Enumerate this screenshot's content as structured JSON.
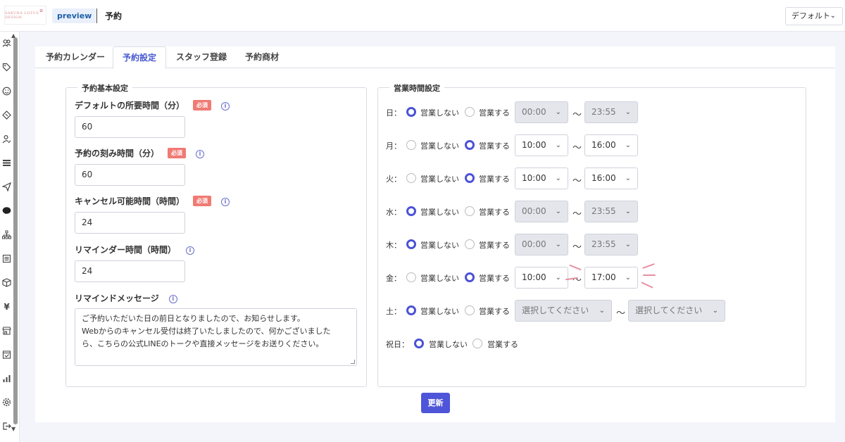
{
  "header": {
    "logo_text": "SAKURA LOTUS DESIGN",
    "preview_badge": "preview",
    "page_title": "予約",
    "default_select": "デフォルト"
  },
  "tabs": [
    {
      "label": "予約カレンダー",
      "active": false
    },
    {
      "label": "予約設定",
      "active": true
    },
    {
      "label": "スタッフ登録",
      "active": false
    },
    {
      "label": "予約商材",
      "active": false
    }
  ],
  "basic_settings": {
    "legend": "予約基本設定",
    "required_label": "必須",
    "fields": [
      {
        "label": "デフォルトの所要時間（分）",
        "value": "60",
        "required": true
      },
      {
        "label": "予約の刻み時間（分）",
        "value": "60",
        "required": true
      },
      {
        "label": "キャンセル可能時間（時間）",
        "value": "24",
        "required": true
      },
      {
        "label": "リマインダー時間（時間）",
        "value": "24",
        "required": false
      }
    ],
    "remind_message": {
      "label": "リマインドメッセージ",
      "lines": [
        "ご予約いただいた日の前日となりましたので、お知らせします。",
        "Webからのキャンセル受付は終了いたしましたので、何かございました",
        "ら、こちらの公式LINEのトークや直接メッセージをお送りください。"
      ]
    }
  },
  "business_hours": {
    "legend": "営業時間設定",
    "closed_label": "営業しない",
    "open_label": "営業する",
    "tilde": "〜",
    "days": [
      {
        "day": "日：",
        "open": false,
        "start": "00:00",
        "end": "23:55",
        "disabled": true
      },
      {
        "day": "月：",
        "open": true,
        "start": "10:00",
        "end": "16:00",
        "disabled": false
      },
      {
        "day": "火：",
        "open": true,
        "start": "10:00",
        "end": "16:00",
        "disabled": false
      },
      {
        "day": "水：",
        "open": false,
        "start": "00:00",
        "end": "23:55",
        "disabled": true
      },
      {
        "day": "木：",
        "open": false,
        "start": "00:00",
        "end": "23:55",
        "disabled": true
      },
      {
        "day": "金：",
        "open": true,
        "start": "10:00",
        "end": "17:00",
        "disabled": false
      },
      {
        "day": "土：",
        "open": false,
        "start": "選択してください",
        "end": "選択してください",
        "disabled": true
      }
    ],
    "holiday": {
      "day": "祝日：",
      "open": false
    }
  },
  "update_button": "更新",
  "colors": {
    "accent": "#4f55d8",
    "required": "#f07a74",
    "badge_bg": "#e9f0fb",
    "badge_text": "#1f5fa8",
    "highlight": "#e88ea0"
  }
}
